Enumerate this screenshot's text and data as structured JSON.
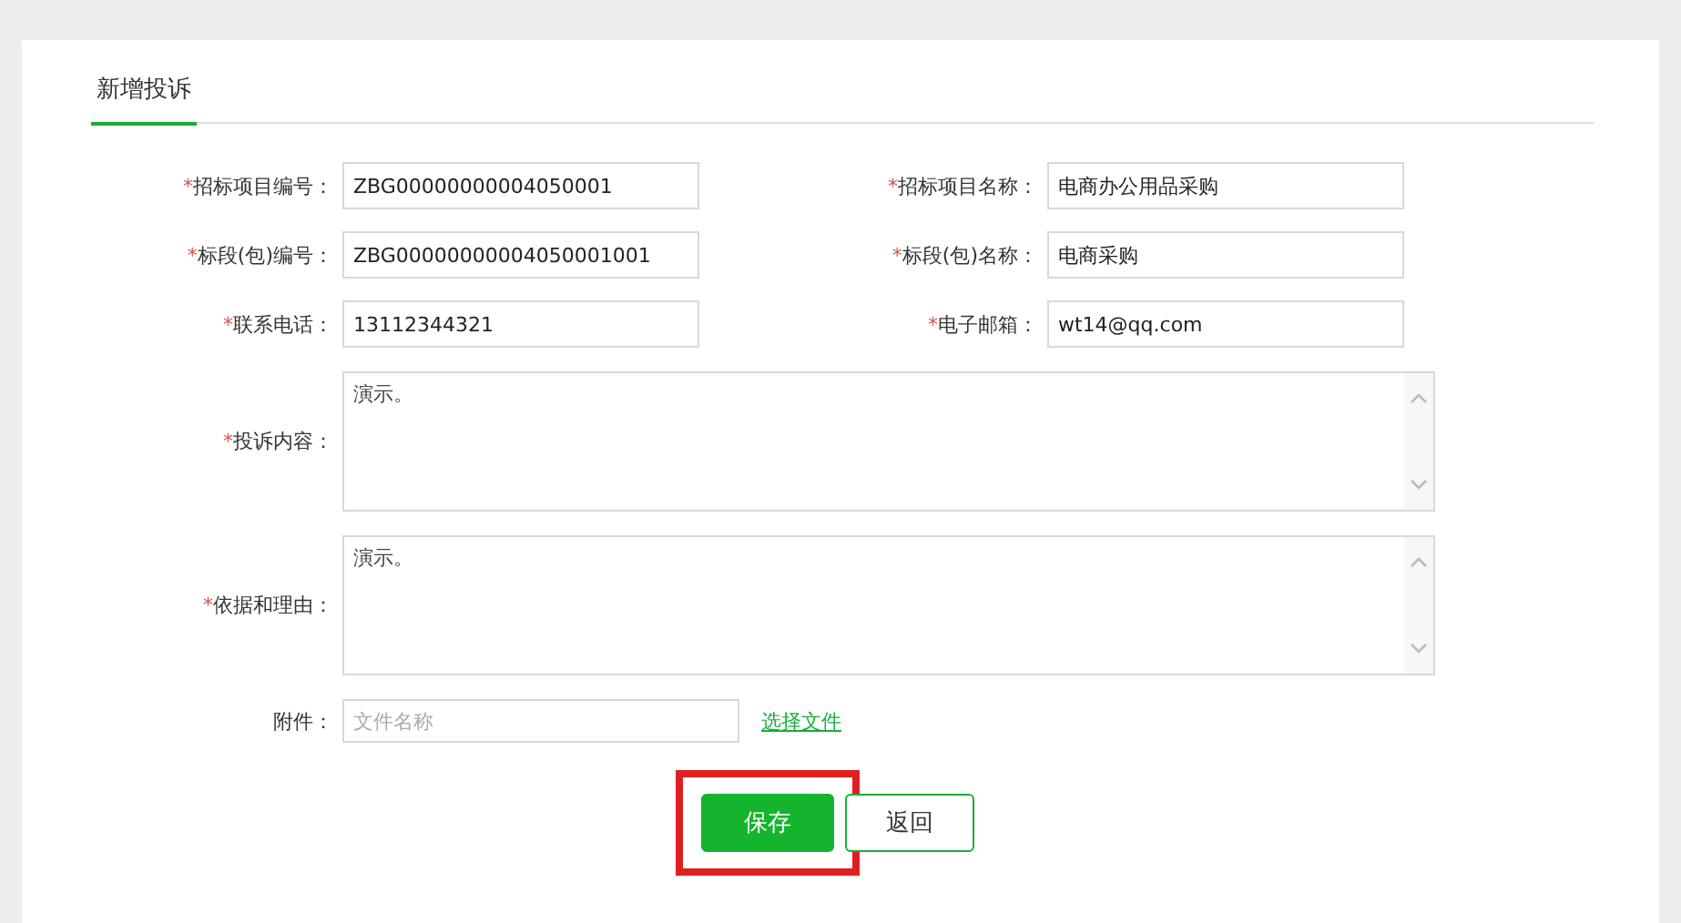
{
  "tab": {
    "label": "新增投诉",
    "selected": true
  },
  "field_rows": [
    {
      "fields": [
        {
          "mark": "*",
          "label": "招标项目编号：",
          "value": "ZBG00000000004050001"
        },
        {
          "mark": "*",
          "label": "招标项目名称：",
          "value": "电商办公用品采购"
        }
      ]
    },
    {
      "fields": [
        {
          "mark": "*",
          "label": "标段(包)编号：",
          "value": "ZBG00000000004050001001"
        },
        {
          "mark": "*",
          "label": "标段(包)名称：",
          "value": "电商采购"
        }
      ]
    },
    {
      "fields": [
        {
          "mark": "*",
          "label": "联系电话：",
          "value": "13112344321"
        },
        {
          "mark": "*",
          "label": "电子邮箱：",
          "value": "wt14@qq.com"
        }
      ]
    }
  ],
  "text_areas": [
    {
      "mark": "*",
      "label": "投诉内容：",
      "value": "演示。"
    },
    {
      "mark": "*",
      "label": "依据和理由：",
      "value": "演示。"
    }
  ],
  "attachment": {
    "label": "附件：",
    "placeholder": "文件名称",
    "link": "选择文件"
  },
  "buttons": [
    {
      "label": "保存",
      "kind": "primary",
      "highlighted": true
    },
    {
      "label": "返回",
      "kind": "secondary",
      "highlighted": false
    }
  ]
}
